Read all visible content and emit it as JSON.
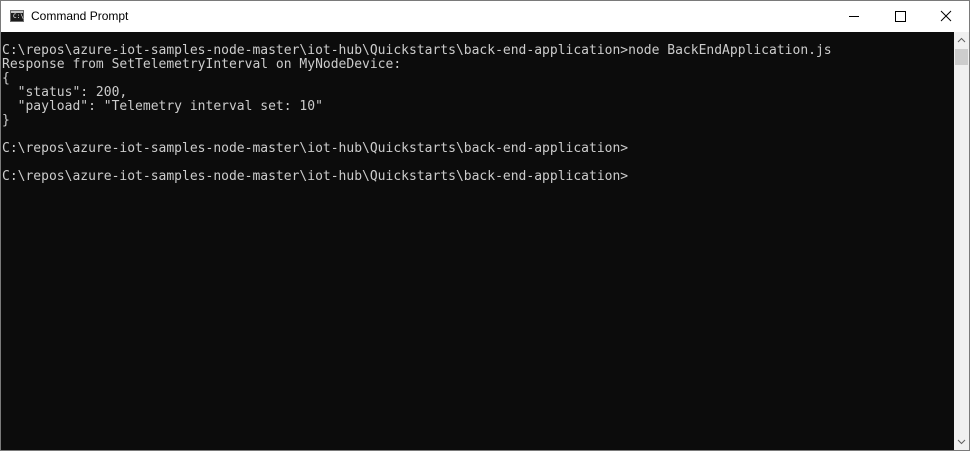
{
  "window": {
    "title": "Command Prompt",
    "icon": "cmd-icon",
    "icon_text": "C:\\.",
    "controls": [
      "minimize-icon",
      "maximize-icon",
      "close-icon"
    ]
  },
  "console": {
    "lines": [
      "C:\\repos\\azure-iot-samples-node-master\\iot-hub\\Quickstarts\\back-end-application>node BackEndApplication.js",
      "Response from SetTelemetryInterval on MyNodeDevice:",
      "{",
      "  \"status\": 200,",
      "  \"payload\": \"Telemetry interval set: 10\"",
      "}",
      "C:\\repos\\azure-iot-samples-node-master\\iot-hub\\Quickstarts\\back-end-application>",
      "C:\\repos\\azure-iot-samples-node-master\\iot-hub\\Quickstarts\\back-end-application>"
    ]
  },
  "colors": {
    "background": "#0c0c0c",
    "text": "#cccccc",
    "titlebar": "#ffffff",
    "scrollbar_track": "#f0f0f0",
    "scrollbar_thumb": "#cdcdcd"
  }
}
